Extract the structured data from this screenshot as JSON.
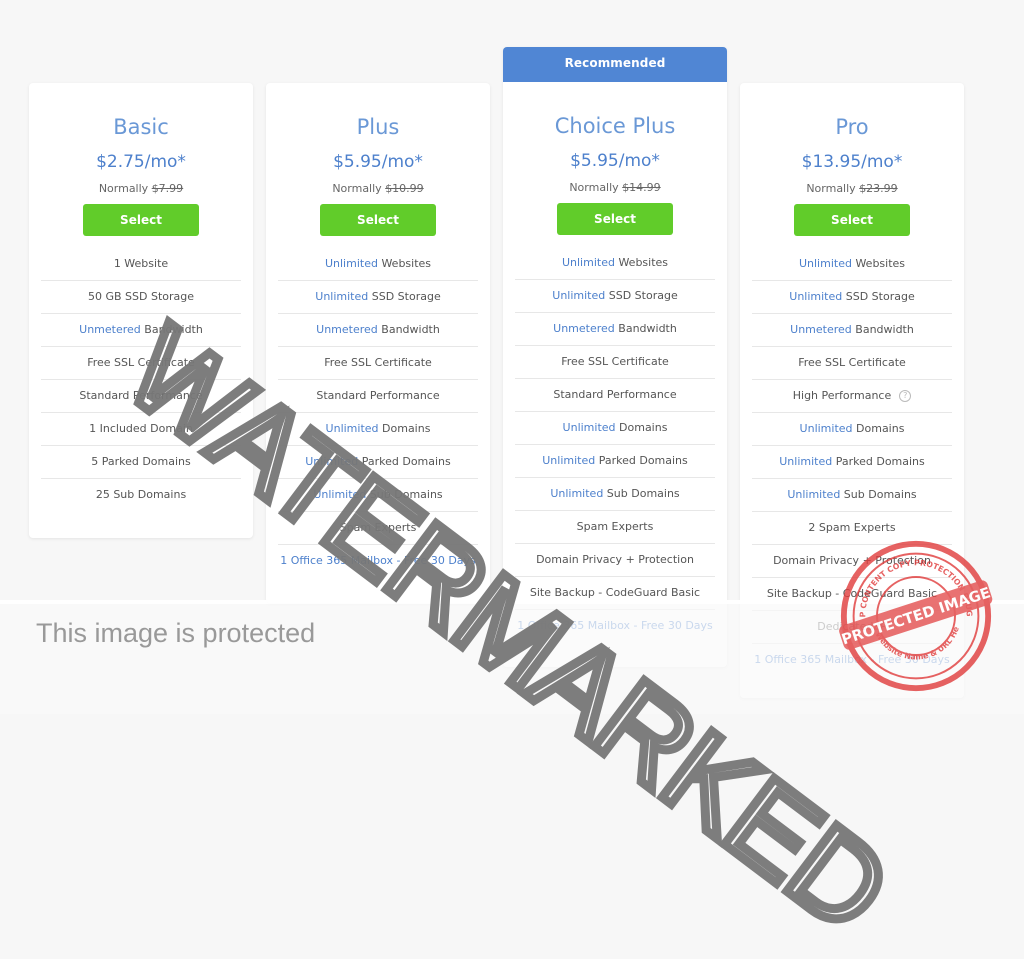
{
  "plans": [
    {
      "name": "Basic",
      "price": "$2.75/mo*",
      "normally_label": "Normally",
      "normally_price": "$7.99",
      "select_label": "Select",
      "features": [
        {
          "hl": "",
          "text": "1 Website"
        },
        {
          "hl": "",
          "text": "50 GB SSD Storage"
        },
        {
          "hl": "Unmetered",
          "text": " Bandwidth"
        },
        {
          "hl": "",
          "text": "Free SSL Certificate"
        },
        {
          "hl": "",
          "text": "Standard Performance"
        },
        {
          "hl": "",
          "text": "1 Included Domain"
        },
        {
          "hl": "",
          "text": "5 Parked Domains"
        },
        {
          "hl": "",
          "text": "25 Sub Domains"
        }
      ]
    },
    {
      "name": "Plus",
      "price": "$5.95/mo*",
      "normally_label": "Normally",
      "normally_price": "$10.99",
      "select_label": "Select",
      "features": [
        {
          "hl": "Unlimited",
          "text": " Websites"
        },
        {
          "hl": "Unlimited",
          "text": " SSD Storage"
        },
        {
          "hl": "Unmetered",
          "text": " Bandwidth"
        },
        {
          "hl": "",
          "text": "Free SSL Certificate"
        },
        {
          "hl": "",
          "text": "Standard Performance"
        },
        {
          "hl": "Unlimited",
          "text": " Domains"
        },
        {
          "hl": "Unlimited",
          "text": " Parked Domains"
        },
        {
          "hl": "Unlimited",
          "text": " Sub Domains"
        },
        {
          "hl": "",
          "text": "Spam Experts"
        }
      ],
      "extra_link": "1 Office 365 Mailbox - Free 30 Days"
    },
    {
      "ribbon": "Recommended",
      "name": "Choice Plus",
      "price": "$5.95/mo*",
      "normally_label": "Normally",
      "normally_price": "$14.99",
      "select_label": "Select",
      "features": [
        {
          "hl": "Unlimited",
          "text": " Websites"
        },
        {
          "hl": "Unlimited",
          "text": " SSD Storage"
        },
        {
          "hl": "Unmetered",
          "text": " Bandwidth"
        },
        {
          "hl": "",
          "text": "Free SSL Certificate"
        },
        {
          "hl": "",
          "text": "Standard Performance"
        },
        {
          "hl": "Unlimited",
          "text": " Domains"
        },
        {
          "hl": "Unlimited",
          "text": " Parked Domains"
        },
        {
          "hl": "Unlimited",
          "text": " Sub Domains"
        },
        {
          "hl": "",
          "text": "Spam Experts"
        },
        {
          "hl": "",
          "text": "Domain Privacy + Protection"
        },
        {
          "hl": "",
          "text": "Site Backup - CodeGuard Basic"
        }
      ],
      "extra_link": "1 Office 365 Mailbox - Free 30 Days"
    },
    {
      "name": "Pro",
      "price": "$13.95/mo*",
      "normally_label": "Normally",
      "normally_price": "$23.99",
      "select_label": "Select",
      "features": [
        {
          "hl": "Unlimited",
          "text": " Websites"
        },
        {
          "hl": "Unlimited",
          "text": " SSD Storage"
        },
        {
          "hl": "Unmetered",
          "text": " Bandwidth"
        },
        {
          "hl": "",
          "text": "Free SSL Certificate"
        },
        {
          "hl": "",
          "text": "High Performance",
          "help": "?"
        },
        {
          "hl": "Unlimited",
          "text": " Domains"
        },
        {
          "hl": "Unlimited",
          "text": " Parked Domains"
        },
        {
          "hl": "Unlimited",
          "text": " Sub Domains"
        },
        {
          "hl": "",
          "text": "2 Spam Experts"
        },
        {
          "hl": "",
          "text": "Domain Privacy + Protection"
        },
        {
          "hl": "",
          "text": "Site Backup - CodeGuard Basic"
        },
        {
          "hl": "",
          "text": "Dedicated IP"
        }
      ],
      "extra_link": "1 Office 365 Mailbox - Free 30 Days"
    }
  ],
  "overlay": {
    "protected_text": "This image is protected",
    "watermark_text": "WATERMARKED",
    "stamp_main": "PROTECTED IMAGE",
    "stamp_top": "WP CONTENT COPY PROTECTION PLUGIN",
    "stamp_bottom": "My Website Name & URL Here"
  },
  "colors": {
    "accent_blue": "#4d80cc",
    "ribbon_blue": "#5086d4",
    "select_green": "#61cc2a",
    "stamp_red": "#e03b3b"
  }
}
